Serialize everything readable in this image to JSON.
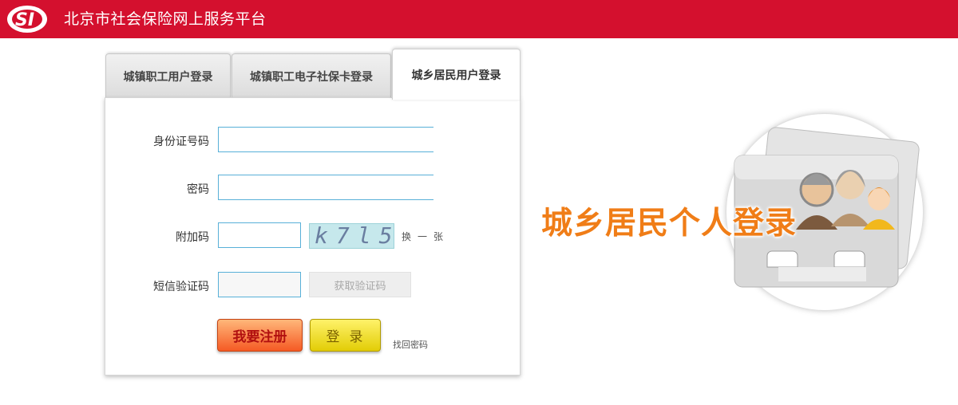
{
  "header": {
    "logo": "si-logo",
    "title": "北京市社会保险网上服务平台",
    "color": "#d4102e"
  },
  "tabs": [
    {
      "label": "城镇职工用户登录",
      "active": false
    },
    {
      "label": "城镇职工电子社保卡登录",
      "active": false
    },
    {
      "label": "城乡居民用户登录",
      "active": true
    }
  ],
  "form": {
    "id_label": "身份证号码",
    "id_value": "",
    "password_label": "密码",
    "password_value": "",
    "captcha_label": "附加码",
    "captcha_value": "",
    "captcha_image_text": "k7l5",
    "captcha_refresh": "换一张",
    "sms_label": "短信验证码",
    "sms_value": "",
    "sms_button": "获取验证码",
    "register_button": "我要注册",
    "login_button": "登录",
    "forgot_link": "找回密码"
  },
  "promo": {
    "text": "城乡居民个人登录",
    "icon": "elderly-family-card-icon",
    "text_color": "#f07d17"
  }
}
